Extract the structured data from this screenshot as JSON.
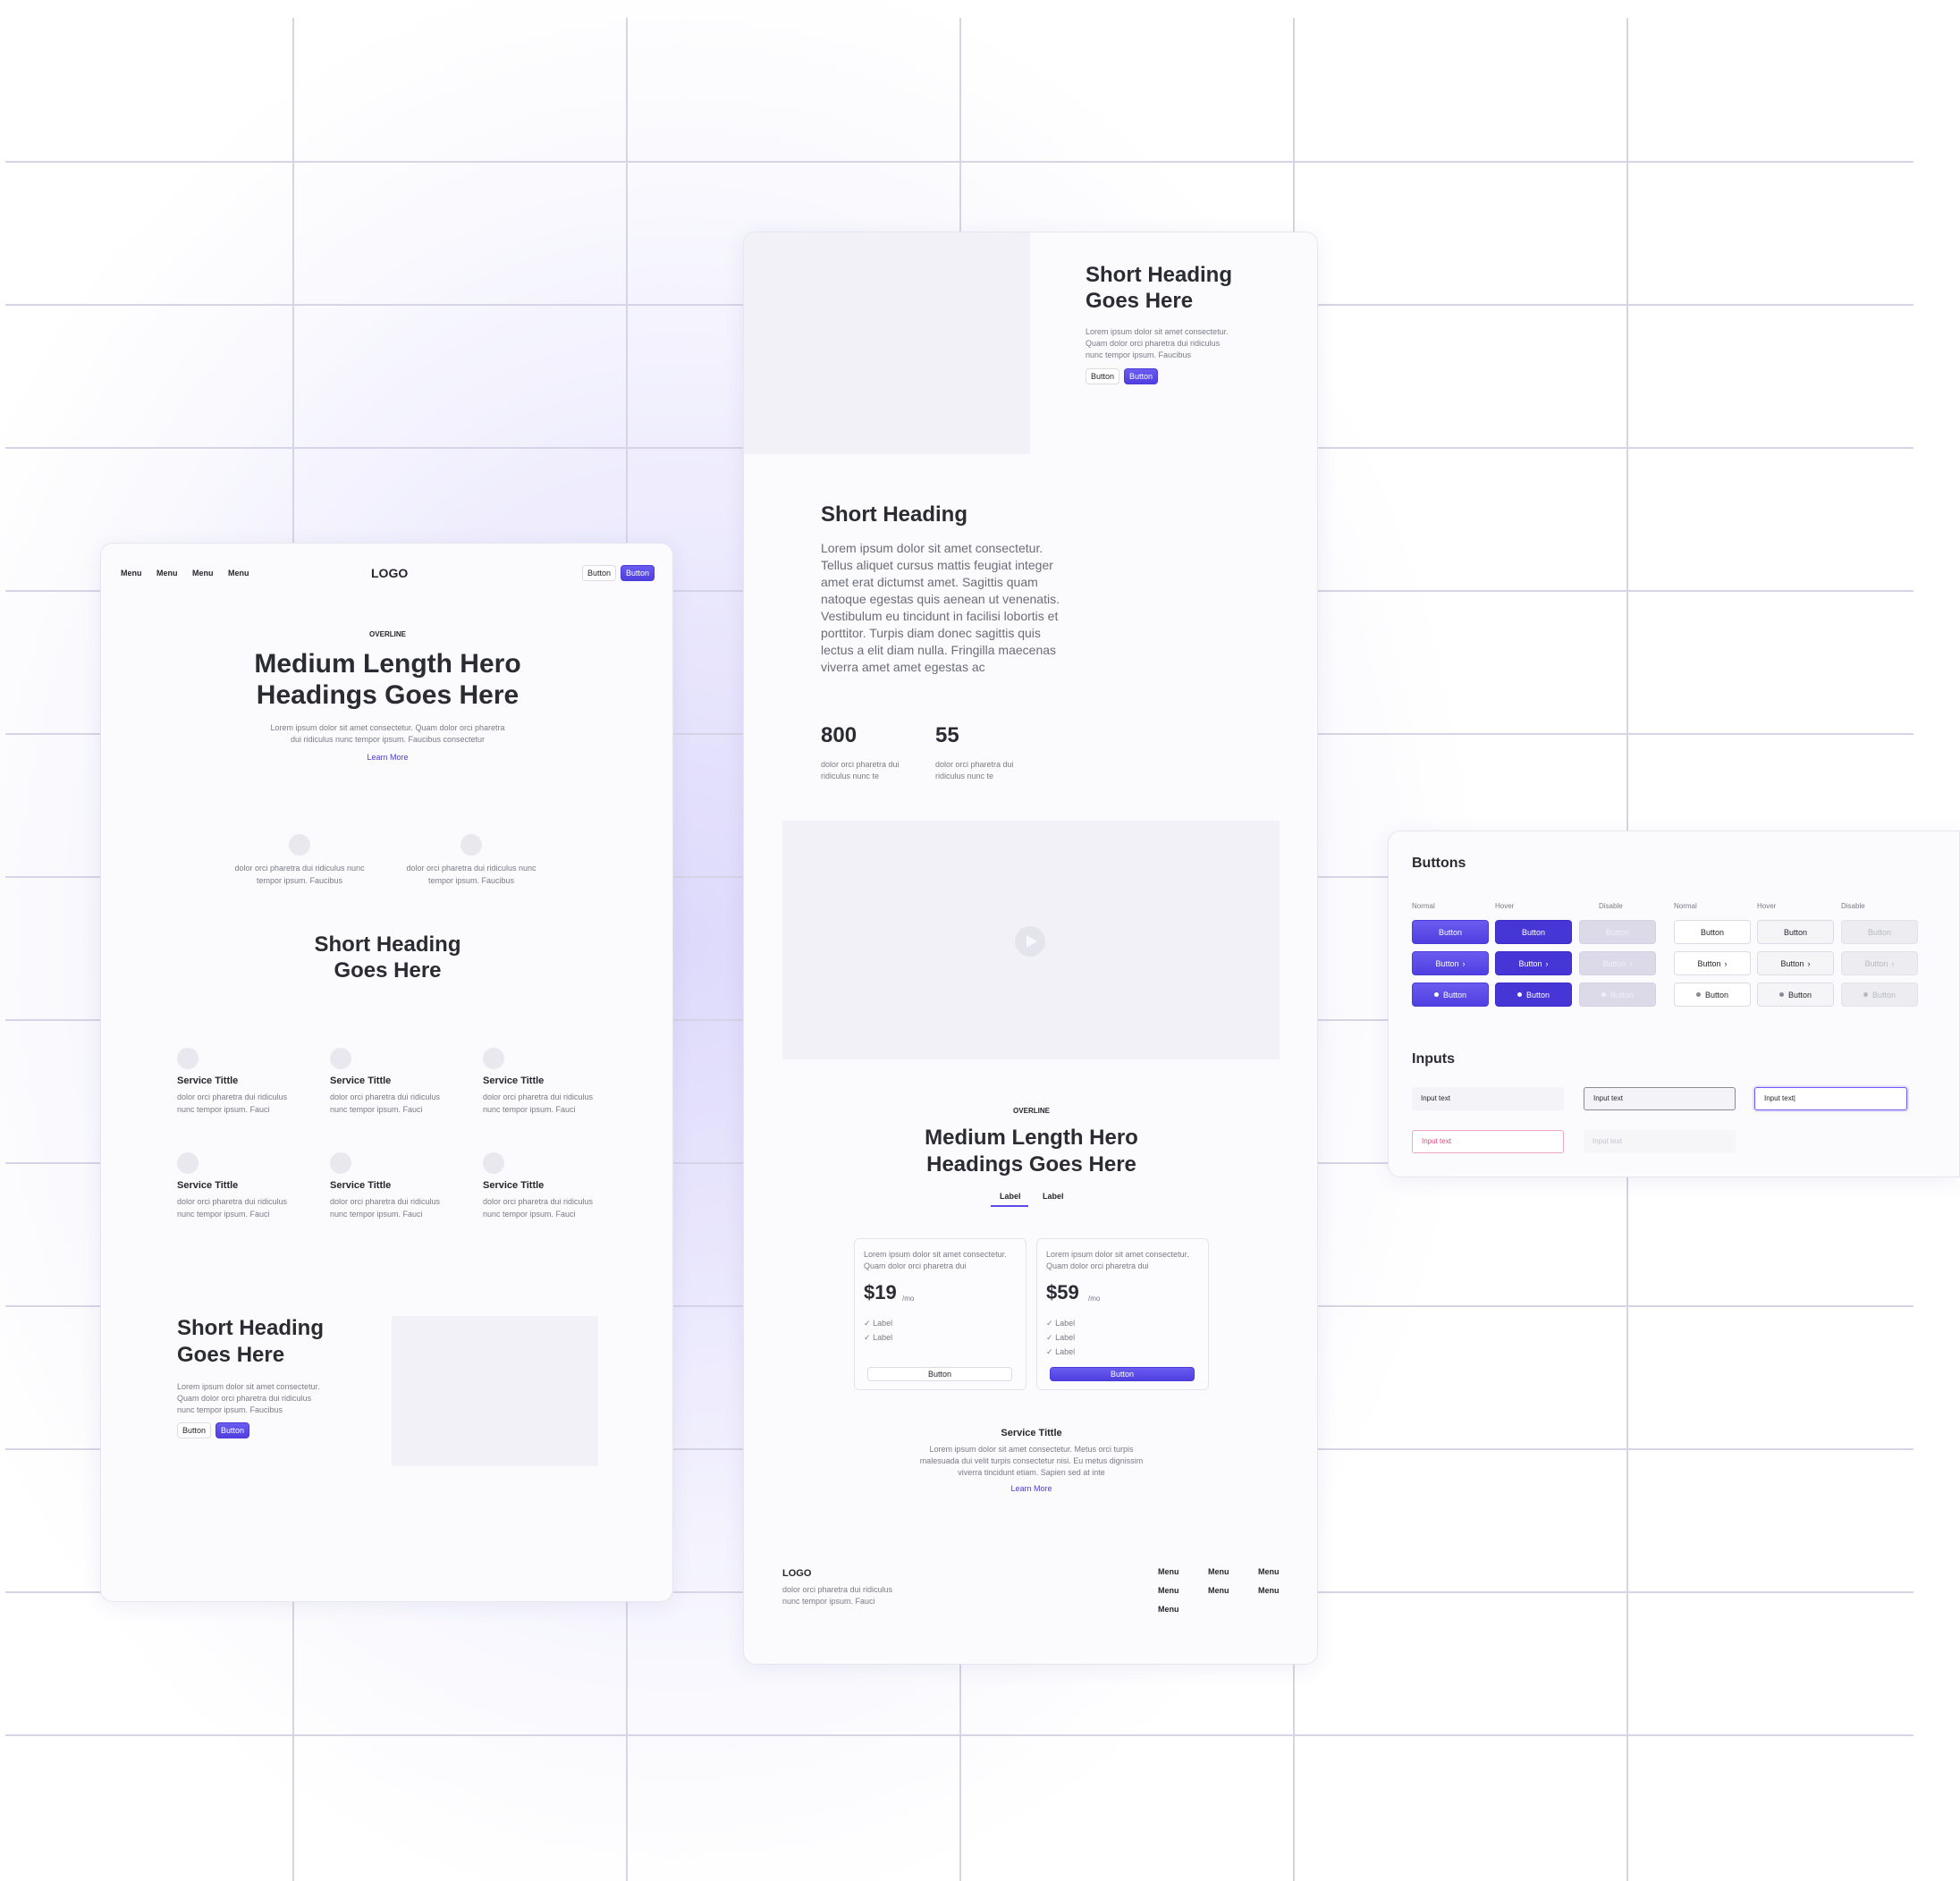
{
  "colors": {
    "accent": "#5b4be8",
    "accent_hover": "#4636d6",
    "error": "#e8467c"
  },
  "left_card": {
    "nav": {
      "menus": [
        "Menu",
        "Menu",
        "Menu",
        "Menu"
      ],
      "logo": "LOGO",
      "btn_outline": "Button",
      "btn_primary": "Button"
    },
    "hero": {
      "overline": "OVERLINE",
      "title_line1": "Medium Length Hero",
      "title_line2": "Headings Goes Here",
      "text_line1": "Lorem ipsum dolor sit amet consectetur. Quam dolor orci pharetra",
      "text_line2": "dui ridiculus nunc tempor ipsum. Faucibus consectetur",
      "link": "Learn More"
    },
    "features": [
      {
        "line1": "dolor orci pharetra dui ridiculus nunc",
        "line2": "tempor ipsum. Faucibus"
      },
      {
        "line1": "dolor orci pharetra dui ridiculus nunc",
        "line2": "tempor ipsum. Faucibus"
      }
    ],
    "section_heading_line1": "Short Heading",
    "section_heading_line2": "Goes Here",
    "services": [
      {
        "title": "Service Tittle",
        "line1": "dolor orci pharetra dui ridiculus",
        "line2": "nunc tempor ipsum. Fauci"
      },
      {
        "title": "Service Tittle",
        "line1": "dolor orci pharetra dui ridiculus",
        "line2": "nunc tempor ipsum. Fauci"
      },
      {
        "title": "Service Tittle",
        "line1": "dolor orci pharetra dui ridiculus",
        "line2": "nunc tempor ipsum. Fauci"
      },
      {
        "title": "Service Tittle",
        "line1": "dolor orci pharetra dui ridiculus",
        "line2": "nunc tempor ipsum. Fauci"
      },
      {
        "title": "Service Tittle",
        "line1": "dolor orci pharetra dui ridiculus",
        "line2": "nunc tempor ipsum. Fauci"
      },
      {
        "title": "Service Tittle",
        "line1": "dolor orci pharetra dui ridiculus",
        "line2": "nunc tempor ipsum. Fauci"
      }
    ],
    "bottom": {
      "heading_line1": "Short Heading",
      "heading_line2": "Goes Here",
      "text_line1": "Lorem ipsum dolor sit amet consectetur.",
      "text_line2": "Quam dolor orci pharetra dui ridiculus",
      "text_line3": "nunc tempor ipsum. Faucibus",
      "btn_outline": "Button",
      "btn_primary": "Button"
    }
  },
  "middle_card": {
    "top": {
      "heading_line1": "Short Heading",
      "heading_line2": "Goes Here",
      "text_line1": "Lorem ipsum dolor sit amet consectetur.",
      "text_line2": "Quam dolor orci pharetra dui ridiculus",
      "text_line3": "nunc tempor ipsum. Faucibus",
      "btn_outline": "Button",
      "btn_primary": "Button"
    },
    "about": {
      "heading": "Short Heading",
      "paragraph": [
        "Lorem ipsum dolor sit amet consectetur.",
        "Tellus aliquet cursus mattis feugiat integer",
        "amet erat dictumst amet. Sagittis quam",
        "natoque egestas quis aenean ut venenatis.",
        "Vestibulum eu tincidunt in facilisi lobortis et",
        "porttitor. Turpis diam donec sagittis quis",
        "lectus a elit diam nulla. Fringilla maecenas",
        "viverra amet amet egestas ac"
      ]
    },
    "stats": [
      {
        "value": "800",
        "line1": "dolor orci pharetra dui",
        "line2": "ridiculus nunc te"
      },
      {
        "value": "55",
        "line1": "dolor orci pharetra dui",
        "line2": "ridiculus nunc te"
      }
    ],
    "pricing": {
      "overline": "OVERLINE",
      "title_line1": "Medium Length Hero",
      "title_line2": "Headings Goes Here",
      "tabs": [
        "Label",
        "Label"
      ],
      "plans": [
        {
          "desc_line1": "Lorem ipsum dolor sit amet consectetur.",
          "desc_line2": "Quam dolor orci pharetra dui",
          "price": "$19",
          "period": "/mo",
          "features": [
            "Label",
            "Label"
          ],
          "button": "Button"
        },
        {
          "desc_line1": "Lorem ipsum dolor sit amet consectetur.",
          "desc_line2": "Quam dolor orci pharetra dui",
          "price": "$59",
          "period": "/mo",
          "features": [
            "Label",
            "Label",
            "Label"
          ],
          "button": "Button"
        }
      ]
    },
    "service": {
      "title": "Service Tittle",
      "line1": "Lorem ipsum dolor sit amet consectetur. Metus orci turpis",
      "line2": "malesuada dui velit turpis consectetur nisi. Eu metus dignissim",
      "line3": "viverra tincidunt etiam. Sapien sed at inte",
      "link": "Learn More"
    },
    "footer": {
      "logo": "LOGO",
      "line1": "dolor orci pharetra dui ridiculus",
      "line2": "nunc tempor ipsum. Fauci",
      "menus": [
        "Menu",
        "Menu",
        "Menu",
        "Menu",
        "Menu",
        "Menu",
        "Menu"
      ]
    }
  },
  "right_card": {
    "buttons_title": "Buttons",
    "col_headers": [
      "Normal",
      "Hover",
      "Disable",
      "Normal",
      "Hover",
      "Disable"
    ],
    "button_label": "Button",
    "inputs_title": "Inputs",
    "inputs": {
      "normal": "Input text",
      "hover": "Input text",
      "focus": "Input text|",
      "error": "Input text",
      "disabled": "Input text"
    }
  }
}
